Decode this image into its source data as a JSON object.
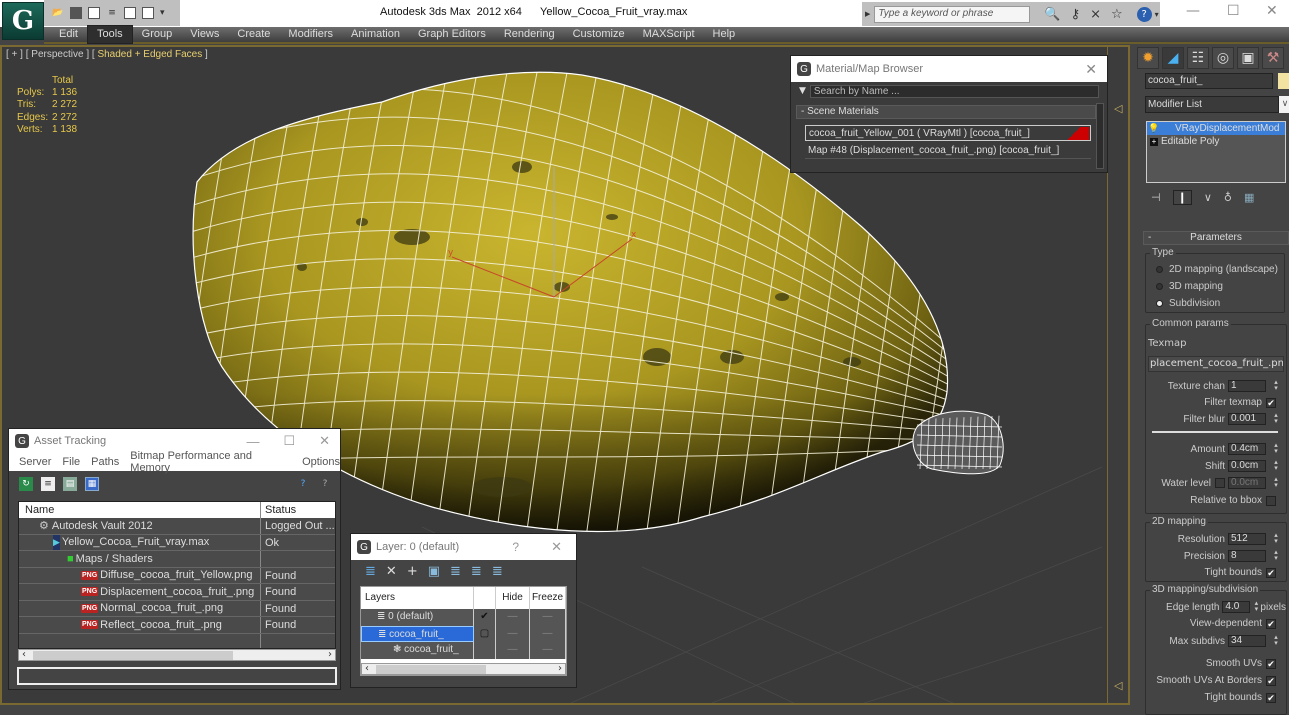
{
  "app": {
    "title": "Autodesk 3ds Max  2012 x64      Yellow_Cocoa_Fruit_vray.max",
    "logo_glyph": "G",
    "quick_access": [
      "open-icon",
      "save-icon",
      "new-icon",
      "hold-icon",
      "undo-icon",
      "redo-icon",
      "dropdown-icon"
    ],
    "search_placeholder": "Type a keyword or phrase",
    "help_glyph": "?",
    "window_controls": {
      "minimize": "—",
      "maximize": "☐",
      "close": "✕"
    }
  },
  "menu": [
    "Edit",
    "Tools",
    "Group",
    "Views",
    "Create",
    "Modifiers",
    "Animation",
    "Graph Editors",
    "Rendering",
    "Customize",
    "MAXScript",
    "Help"
  ],
  "menu_active": "Tools",
  "viewport": {
    "label_prefix": "[ + ] [ Perspective ] [ ",
    "label_shading": "Shaded + Edged Faces",
    "label_suffix": " ]",
    "stats": {
      "header": "Total",
      "rows": [
        {
          "k": "Polys:",
          "v": "1 136"
        },
        {
          "k": "Tris:",
          "v": "2 272"
        },
        {
          "k": "Edges:",
          "v": "2 272"
        },
        {
          "k": "Verts:",
          "v": "1 138"
        }
      ]
    },
    "gizmo": {
      "x_label": "x",
      "y_label": "y"
    },
    "colors": {
      "fruit": "#b3a222",
      "wire": "#ffffff",
      "background": "#3a3a3a"
    }
  },
  "material_browser": {
    "title": "Material/Map Browser",
    "search_placeholder": "Search by Name ...",
    "group": "- Scene Materials",
    "items": [
      "cocoa_fruit_Yellow_001  ( VRayMtl ) [cocoa_fruit_]",
      "Map #48 (Displacement_cocoa_fruit_.png) [cocoa_fruit_]"
    ]
  },
  "command_panel": {
    "object_name": "cocoa_fruit_",
    "object_color": "#f2e3a3",
    "modifier_list": "Modifier List",
    "stack": [
      {
        "label": "VRayDisplacementMod",
        "selected": true
      },
      {
        "label": "Editable Poly",
        "selected": false
      }
    ],
    "rollout_title": "Parameters",
    "type_group": "Type",
    "type_options": [
      {
        "label": "2D mapping (landscape)",
        "selected": false
      },
      {
        "label": "3D mapping",
        "selected": false
      },
      {
        "label": "Subdivision",
        "selected": true
      }
    ],
    "common_group": "Common params",
    "texmap_label": "Texmap",
    "texmap_value": "placement_cocoa_fruit_.png)",
    "texture_chan": {
      "label": "Texture chan",
      "value": "1"
    },
    "filter_texmap": {
      "label": "Filter texmap",
      "checked": true
    },
    "filter_blur": {
      "label": "Filter blur",
      "value": "0.001"
    },
    "amount": {
      "label": "Amount",
      "value": "0.4cm"
    },
    "shift": {
      "label": "Shift",
      "value": "0.0cm"
    },
    "water_level": {
      "label": "Water level",
      "value": "0.0cm",
      "checked": false
    },
    "relative_bbox": {
      "label": "Relative to bbox",
      "checked": false
    },
    "mapping2d_group": "2D mapping",
    "resolution": {
      "label": "Resolution",
      "value": "512"
    },
    "precision": {
      "label": "Precision",
      "value": "8"
    },
    "tight_bounds_2d": {
      "label": "Tight bounds",
      "checked": true
    },
    "mapping3d_group": "3D mapping/subdivision",
    "edge_length": {
      "label": "Edge length",
      "value": "4.0",
      "unit": "pixels"
    },
    "view_dependent": {
      "label": "View-dependent",
      "checked": true
    },
    "max_subdivs": {
      "label": "Max subdivs",
      "value": "34"
    },
    "smooth_uvs": {
      "label": "Smooth UVs",
      "checked": true
    },
    "smooth_uvs_borders": {
      "label": "Smooth UVs At Borders",
      "checked": true
    },
    "tight_bounds_3d": {
      "label": "Tight bounds",
      "checked": true
    }
  },
  "asset_tracking": {
    "title": "Asset Tracking",
    "menu": [
      "Server",
      "File",
      "Paths",
      "Bitmap Performance and Memory",
      "Options"
    ],
    "columns": [
      "Name",
      "Status"
    ],
    "rows": [
      {
        "name": "Autodesk Vault 2012",
        "status": "Logged Out ...",
        "indent": 1,
        "icon": "vault-icon"
      },
      {
        "name": "Yellow_Cocoa_Fruit_vray.max",
        "status": "Ok",
        "indent": 2,
        "icon": "max-file-icon"
      },
      {
        "name": "Maps / Shaders",
        "status": "",
        "indent": 3,
        "icon": "maps-icon"
      },
      {
        "name": "Diffuse_cocoa_fruit_Yellow.png",
        "status": "Found",
        "indent": 4,
        "icon": "png-icon"
      },
      {
        "name": "Displacement_cocoa_fruit_.png",
        "status": "Found",
        "indent": 4,
        "icon": "png-icon"
      },
      {
        "name": "Normal_cocoa_fruit_.png",
        "status": "Found",
        "indent": 4,
        "icon": "png-icon"
      },
      {
        "name": "Reflect_cocoa_fruit_.png",
        "status": "Found",
        "indent": 4,
        "icon": "png-icon"
      }
    ],
    "png_badge": "PNG"
  },
  "layer_dialog": {
    "title": "Layer: 0 (default)",
    "help": "?",
    "columns": [
      "Layers",
      "",
      "Hide",
      "Freeze"
    ],
    "rows": [
      {
        "name": "0 (default)",
        "current": "✔",
        "selected": false,
        "indent": 1
      },
      {
        "name": "cocoa_fruit_",
        "current": "▢",
        "selected": true,
        "indent": 1
      },
      {
        "name": "cocoa_fruit_",
        "current": "",
        "selected": false,
        "indent": 2
      }
    ],
    "dash": "—"
  }
}
